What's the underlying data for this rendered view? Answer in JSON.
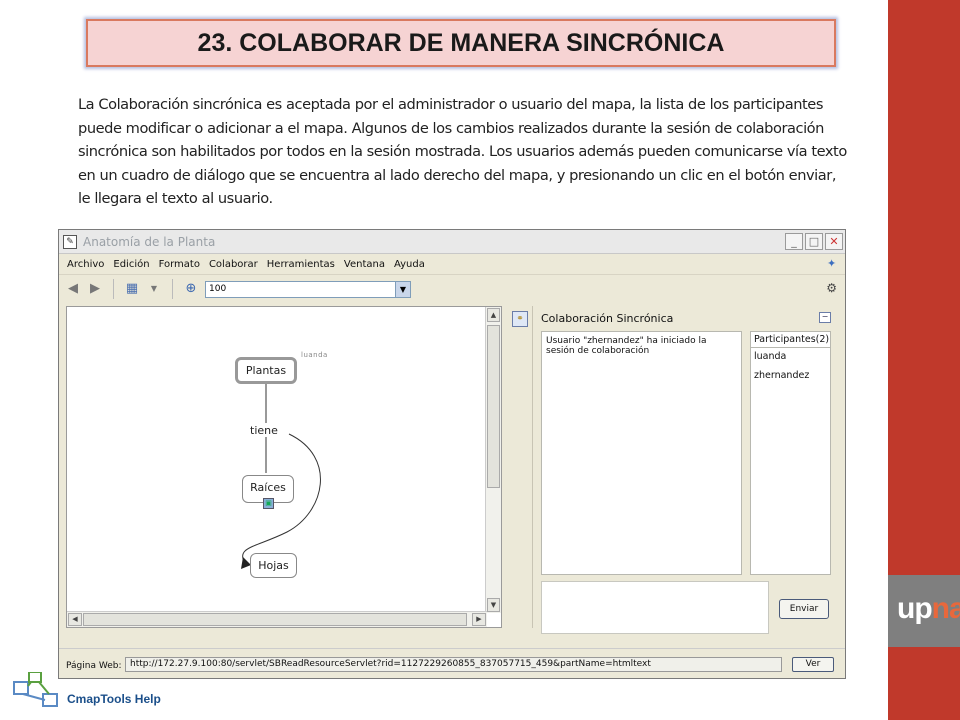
{
  "slide": {
    "title": "23. COLABORAR DE MANERA SINCRÓNICA",
    "paragraph": "La Colaboración sincrónica es aceptada por el administrador o usuario del mapa, la lista de los participantes puede modificar o adicionar a el mapa. Algunos de los cambios realizados durante la sesión de colaboración sincrónica son habilitados por todos en la sesión mostrada. Los usuarios además pueden comunicarse vía texto en un cuadro de diálogo que se encuentra al lado derecho del mapa, y presionando un clic en el botón enviar, le llegara el texto al usuario."
  },
  "window": {
    "title": "Anatomía de la Planta",
    "menu": [
      "Archivo",
      "Edición",
      "Formato",
      "Colaborar",
      "Herramientas",
      "Ventana",
      "Ayuda"
    ],
    "zoom_value": "100"
  },
  "concept_map": {
    "nodes": [
      "Plantas",
      "Raíces",
      "Hojas"
    ],
    "link_word": "tiene",
    "author": "luanda"
  },
  "collaboration": {
    "title": "Colaboración Sincrónica",
    "chat_message": "Usuario \"zhernandez\" ha iniciado la sesión de colaboración",
    "participants_header": "Participantes(2)",
    "participants": [
      "luanda",
      "zhernandez"
    ],
    "send_label": "Enviar"
  },
  "statusbar": {
    "label": "Página Web:",
    "url": "http://172.27.9.100:80/servlet/SBReadResourceServlet?rid=1127229260855_837057715_459&partName=htmltext",
    "go_label": "Ver"
  },
  "logos": {
    "cmap": "CmapTools Help",
    "upna_a": "up",
    "upna_b": "na"
  },
  "colors": {
    "accent_red": "#c0392b",
    "title_bg": "#f6d3d3",
    "title_border": "#d9795f"
  }
}
